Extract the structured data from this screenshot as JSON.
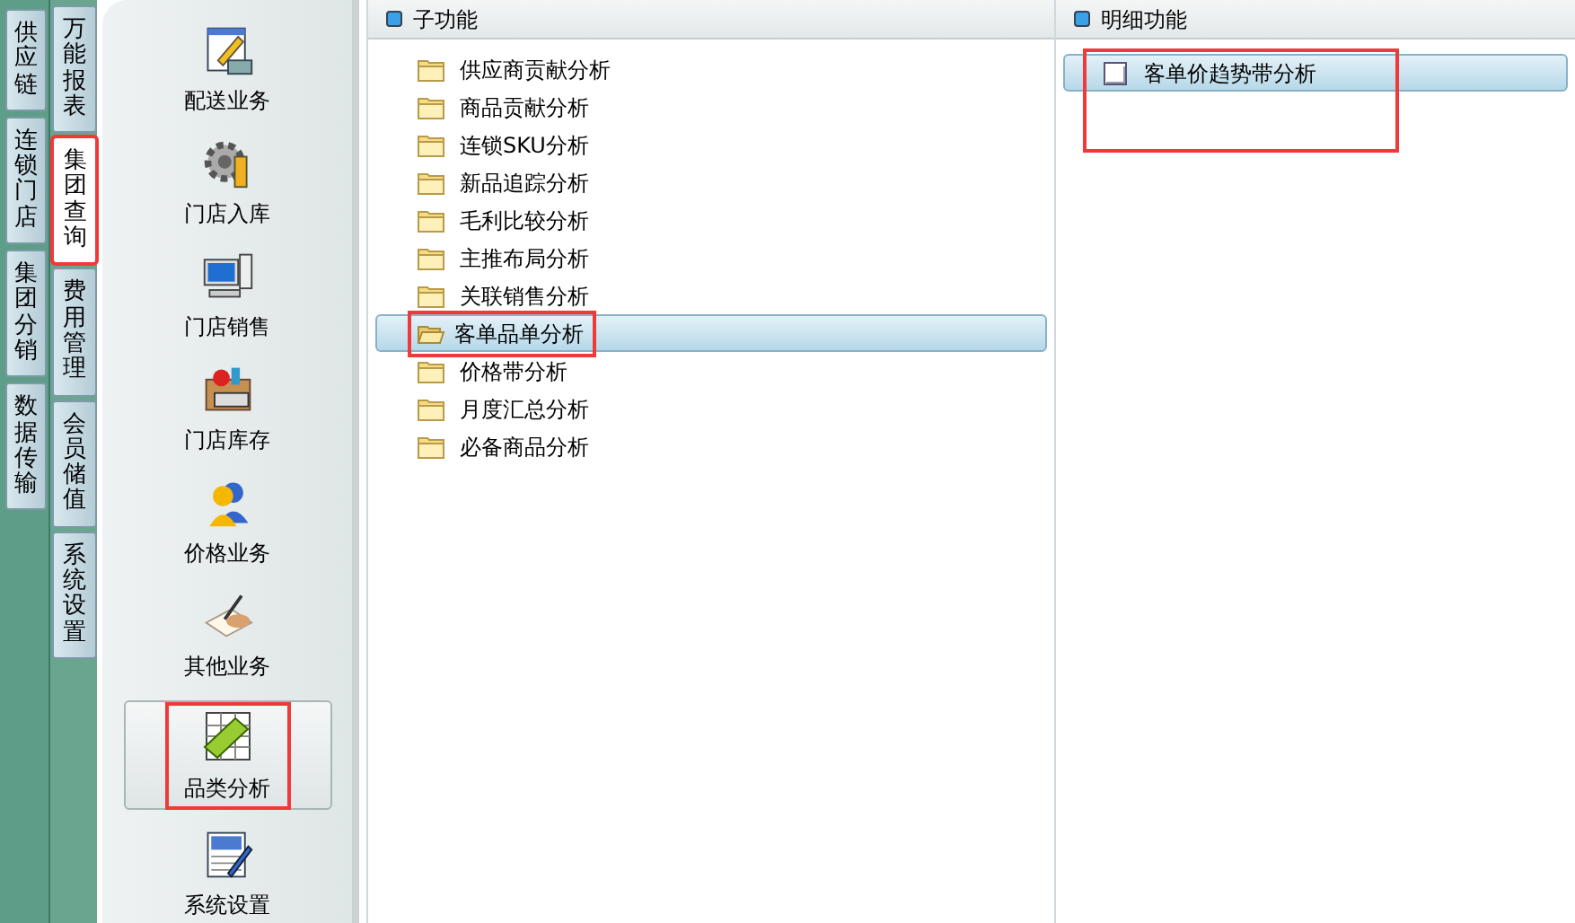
{
  "outer_tabs": [
    {
      "label": "供应链",
      "selected": false
    },
    {
      "label": "连锁门店",
      "selected": false
    },
    {
      "label": "集团分销",
      "selected": false
    },
    {
      "label": "数据传输",
      "selected": false
    }
  ],
  "inner_tabs": [
    {
      "label": "万能报表",
      "selected": false,
      "highlighted": false
    },
    {
      "label": "集团查询",
      "selected": true,
      "highlighted": true
    },
    {
      "label": "费用管理",
      "selected": false,
      "highlighted": false
    },
    {
      "label": "会员储值",
      "selected": false,
      "highlighted": false
    },
    {
      "label": "系统设置",
      "selected": false,
      "highlighted": false
    }
  ],
  "modules": [
    {
      "label": "配送业务",
      "selected": false,
      "highlighted": false
    },
    {
      "label": "门店入库",
      "selected": false,
      "highlighted": false
    },
    {
      "label": "门店销售",
      "selected": false,
      "highlighted": false
    },
    {
      "label": "门店库存",
      "selected": false,
      "highlighted": false
    },
    {
      "label": "价格业务",
      "selected": false,
      "highlighted": false
    },
    {
      "label": "其他业务",
      "selected": false,
      "highlighted": false
    },
    {
      "label": "品类分析",
      "selected": true,
      "highlighted": true
    },
    {
      "label": "系统设置",
      "selected": false,
      "highlighted": false
    }
  ],
  "sub_functions": {
    "title": "子功能",
    "items": [
      {
        "label": "供应商贡献分析",
        "selected": false,
        "highlighted": false
      },
      {
        "label": "商品贡献分析",
        "selected": false,
        "highlighted": false
      },
      {
        "label": "连锁SKU分析",
        "selected": false,
        "highlighted": false
      },
      {
        "label": "新品追踪分析",
        "selected": false,
        "highlighted": false
      },
      {
        "label": "毛利比较分析",
        "selected": false,
        "highlighted": false
      },
      {
        "label": "主推布局分析",
        "selected": false,
        "highlighted": false
      },
      {
        "label": "关联销售分析",
        "selected": false,
        "highlighted": false
      },
      {
        "label": "客单品单分析",
        "selected": true,
        "highlighted": true
      },
      {
        "label": "价格带分析",
        "selected": false,
        "highlighted": false
      },
      {
        "label": "月度汇总分析",
        "selected": false,
        "highlighted": false
      },
      {
        "label": "必备商品分析",
        "selected": false,
        "highlighted": false
      }
    ]
  },
  "detail_functions": {
    "title": "明细功能",
    "items": [
      {
        "label": "客单价趋势带分析",
        "selected": true,
        "highlighted": true
      }
    ]
  }
}
